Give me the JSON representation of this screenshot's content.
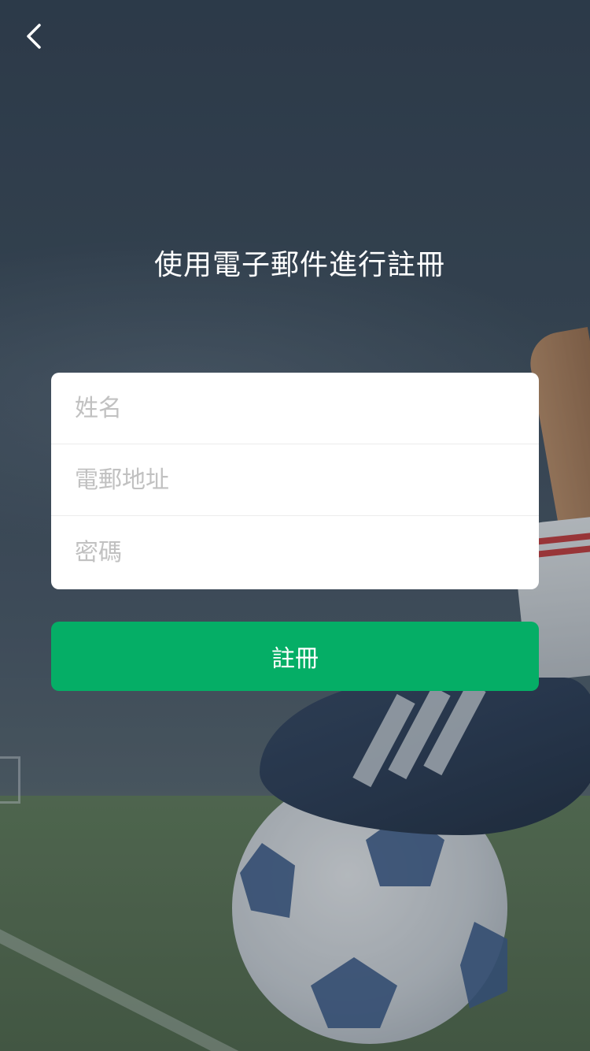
{
  "header": {
    "back_icon": "chevron-left-icon",
    "title": "使用電子郵件進行註冊"
  },
  "form": {
    "fields": [
      {
        "placeholder": "姓名",
        "value": ""
      },
      {
        "placeholder": "電郵地址",
        "value": ""
      },
      {
        "placeholder": "密碼",
        "value": ""
      }
    ],
    "divider_color": "#ececec",
    "placeholder_color": "#c1c1c1"
  },
  "submit": {
    "label": "註冊",
    "color": "#05ae66"
  }
}
